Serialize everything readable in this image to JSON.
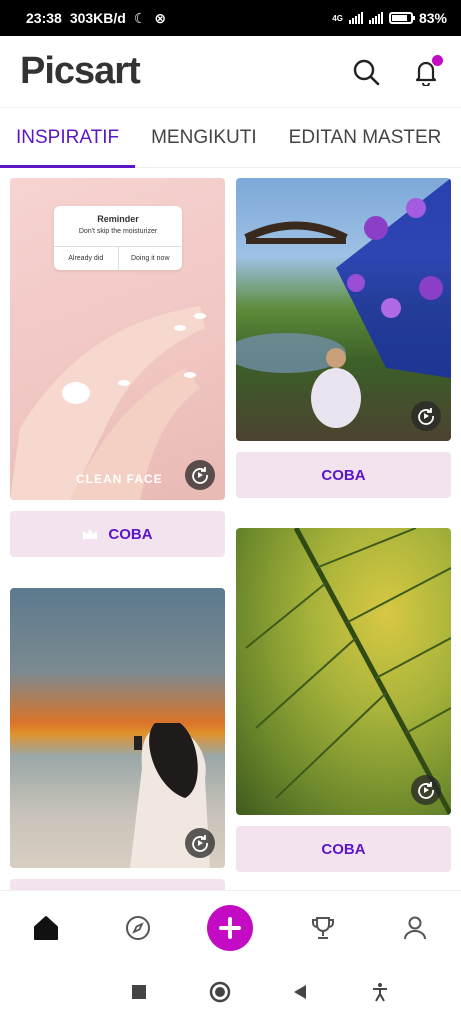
{
  "status": {
    "time": "23:38",
    "speed": "303KB/d",
    "network": "4G",
    "battery": "83%",
    "battery_level": 0.83
  },
  "app": {
    "logo": "Picsart"
  },
  "tabs": [
    {
      "label": "INSPIRATIF",
      "active": true
    },
    {
      "label": "MENGIKUTI",
      "active": false
    },
    {
      "label": "EDITAN MASTER",
      "active": false
    }
  ],
  "cards": {
    "card1": {
      "reminder_title": "Reminder",
      "reminder_text": "Don't skip the moisturizer",
      "reminder_btn1": "Already did",
      "reminder_btn2": "Doing it now",
      "overlay_text": "CLEAN FACE",
      "cta": "COBA"
    },
    "card2": {
      "cta": "COBA"
    },
    "card3": {
      "cta": ""
    },
    "card4": {
      "cta": "COBA"
    }
  },
  "colors": {
    "accent": "#5b17c7",
    "brand": "#c20bc2",
    "cta_bg": "#f2e3ef"
  },
  "nav": [
    "home-icon",
    "explore-icon",
    "create-icon",
    "challenges-icon",
    "profile-icon"
  ]
}
